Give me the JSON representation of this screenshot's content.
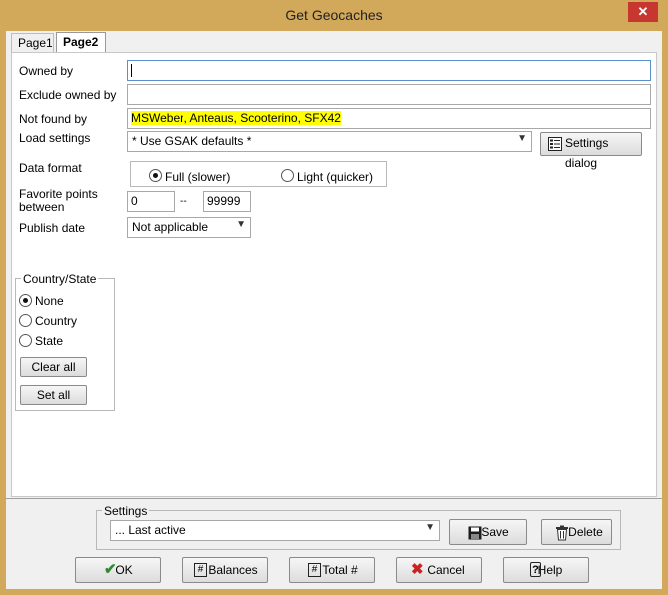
{
  "window": {
    "title": "Get Geocaches",
    "close_glyph": "✕"
  },
  "tabs": [
    {
      "label": "Page1"
    },
    {
      "label": "Page2"
    }
  ],
  "fields": {
    "owned_by_label": "Owned by",
    "owned_by_value": "",
    "exclude_owned_by_label": "Exclude owned by",
    "exclude_owned_by_value": "",
    "not_found_by_label": "Not found by",
    "not_found_by_names": [
      "MSWeber",
      "Anteaus",
      "Scooterino",
      "SFX42"
    ],
    "load_settings_label": "Load settings",
    "load_settings_value": "* Use GSAK defaults *",
    "settings_dialog_label": "Settings dialog",
    "data_format_label": "Data format",
    "data_format_options": [
      "Full (slower)",
      "Light (quicker)"
    ],
    "data_format_selected": "Full (slower)",
    "favorite_points_label_1": "Favorite points",
    "favorite_points_label_2": "between",
    "favorite_min": "0",
    "favorite_sep": "--",
    "favorite_max": "99999",
    "publish_date_label": "Publish date",
    "publish_date_value": "Not applicable"
  },
  "country_state": {
    "title": "Country/State",
    "options": [
      "None",
      "Country",
      "State"
    ],
    "selected": "None",
    "clear_all": "Clear all",
    "set_all": "Set all"
  },
  "settings": {
    "title": "Settings",
    "value": "... Last active",
    "save": "Save",
    "delete": "Delete"
  },
  "buttons": {
    "ok": "OK",
    "balances": "Balances",
    "total": "Total #",
    "cancel": "Cancel",
    "help": "Help"
  },
  "colors": {
    "frame": "#d2a85a",
    "highlight": "#ffff00",
    "close": "#c7372f",
    "ok_check": "#2e8b2e",
    "cancel_x": "#cc2222"
  }
}
